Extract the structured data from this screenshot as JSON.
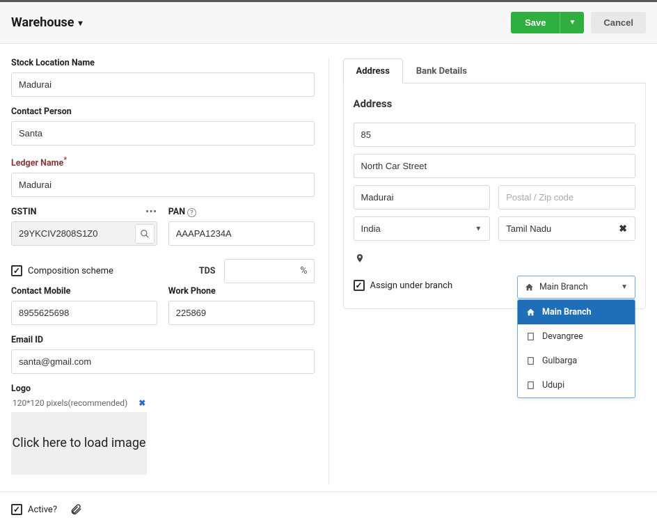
{
  "header": {
    "title": "Warehouse",
    "save_label": "Save",
    "cancel_label": "Cancel"
  },
  "form": {
    "stock_location": {
      "label": "Stock Location Name",
      "value": "Madurai"
    },
    "contact_person": {
      "label": "Contact Person",
      "value": "Santa"
    },
    "ledger_name": {
      "label": "Ledger Name",
      "value": "Madurai"
    },
    "gstin": {
      "label": "GSTIN",
      "value": "29YKCIV2808S1Z0"
    },
    "pan": {
      "label": "PAN",
      "value": "AAAPA1234A"
    },
    "composition": {
      "label": "Composition scheme",
      "checked": true
    },
    "tds": {
      "label": "TDS",
      "value": ""
    },
    "contact_mobile": {
      "label": "Contact Mobile",
      "value": "8955625698"
    },
    "work_phone": {
      "label": "Work Phone",
      "value": "225869"
    },
    "email": {
      "label": "Email ID",
      "value": "santa@gmail.com"
    },
    "logo": {
      "label": "Logo",
      "hint": "120*120 pixels(recommended)",
      "placeholder": "Click here to load image"
    }
  },
  "tabs": {
    "address": "Address",
    "bank": "Bank Details",
    "active": "address"
  },
  "address": {
    "section_title": "Address",
    "line1": "85",
    "line2": "North Car Street",
    "city": "Madurai",
    "postal_placeholder": "Postal / Zip code",
    "postal": "",
    "country": "India",
    "state": "Tamil Nadu",
    "assign_branch_label": "Assign under branch",
    "assign_branch_checked": true,
    "branch_selected": "Main Branch",
    "branch_options": [
      "Main Branch",
      "Devangree",
      "Gulbarga",
      "Udupi"
    ]
  },
  "footer": {
    "active_label": "Active",
    "active_checked": true
  }
}
